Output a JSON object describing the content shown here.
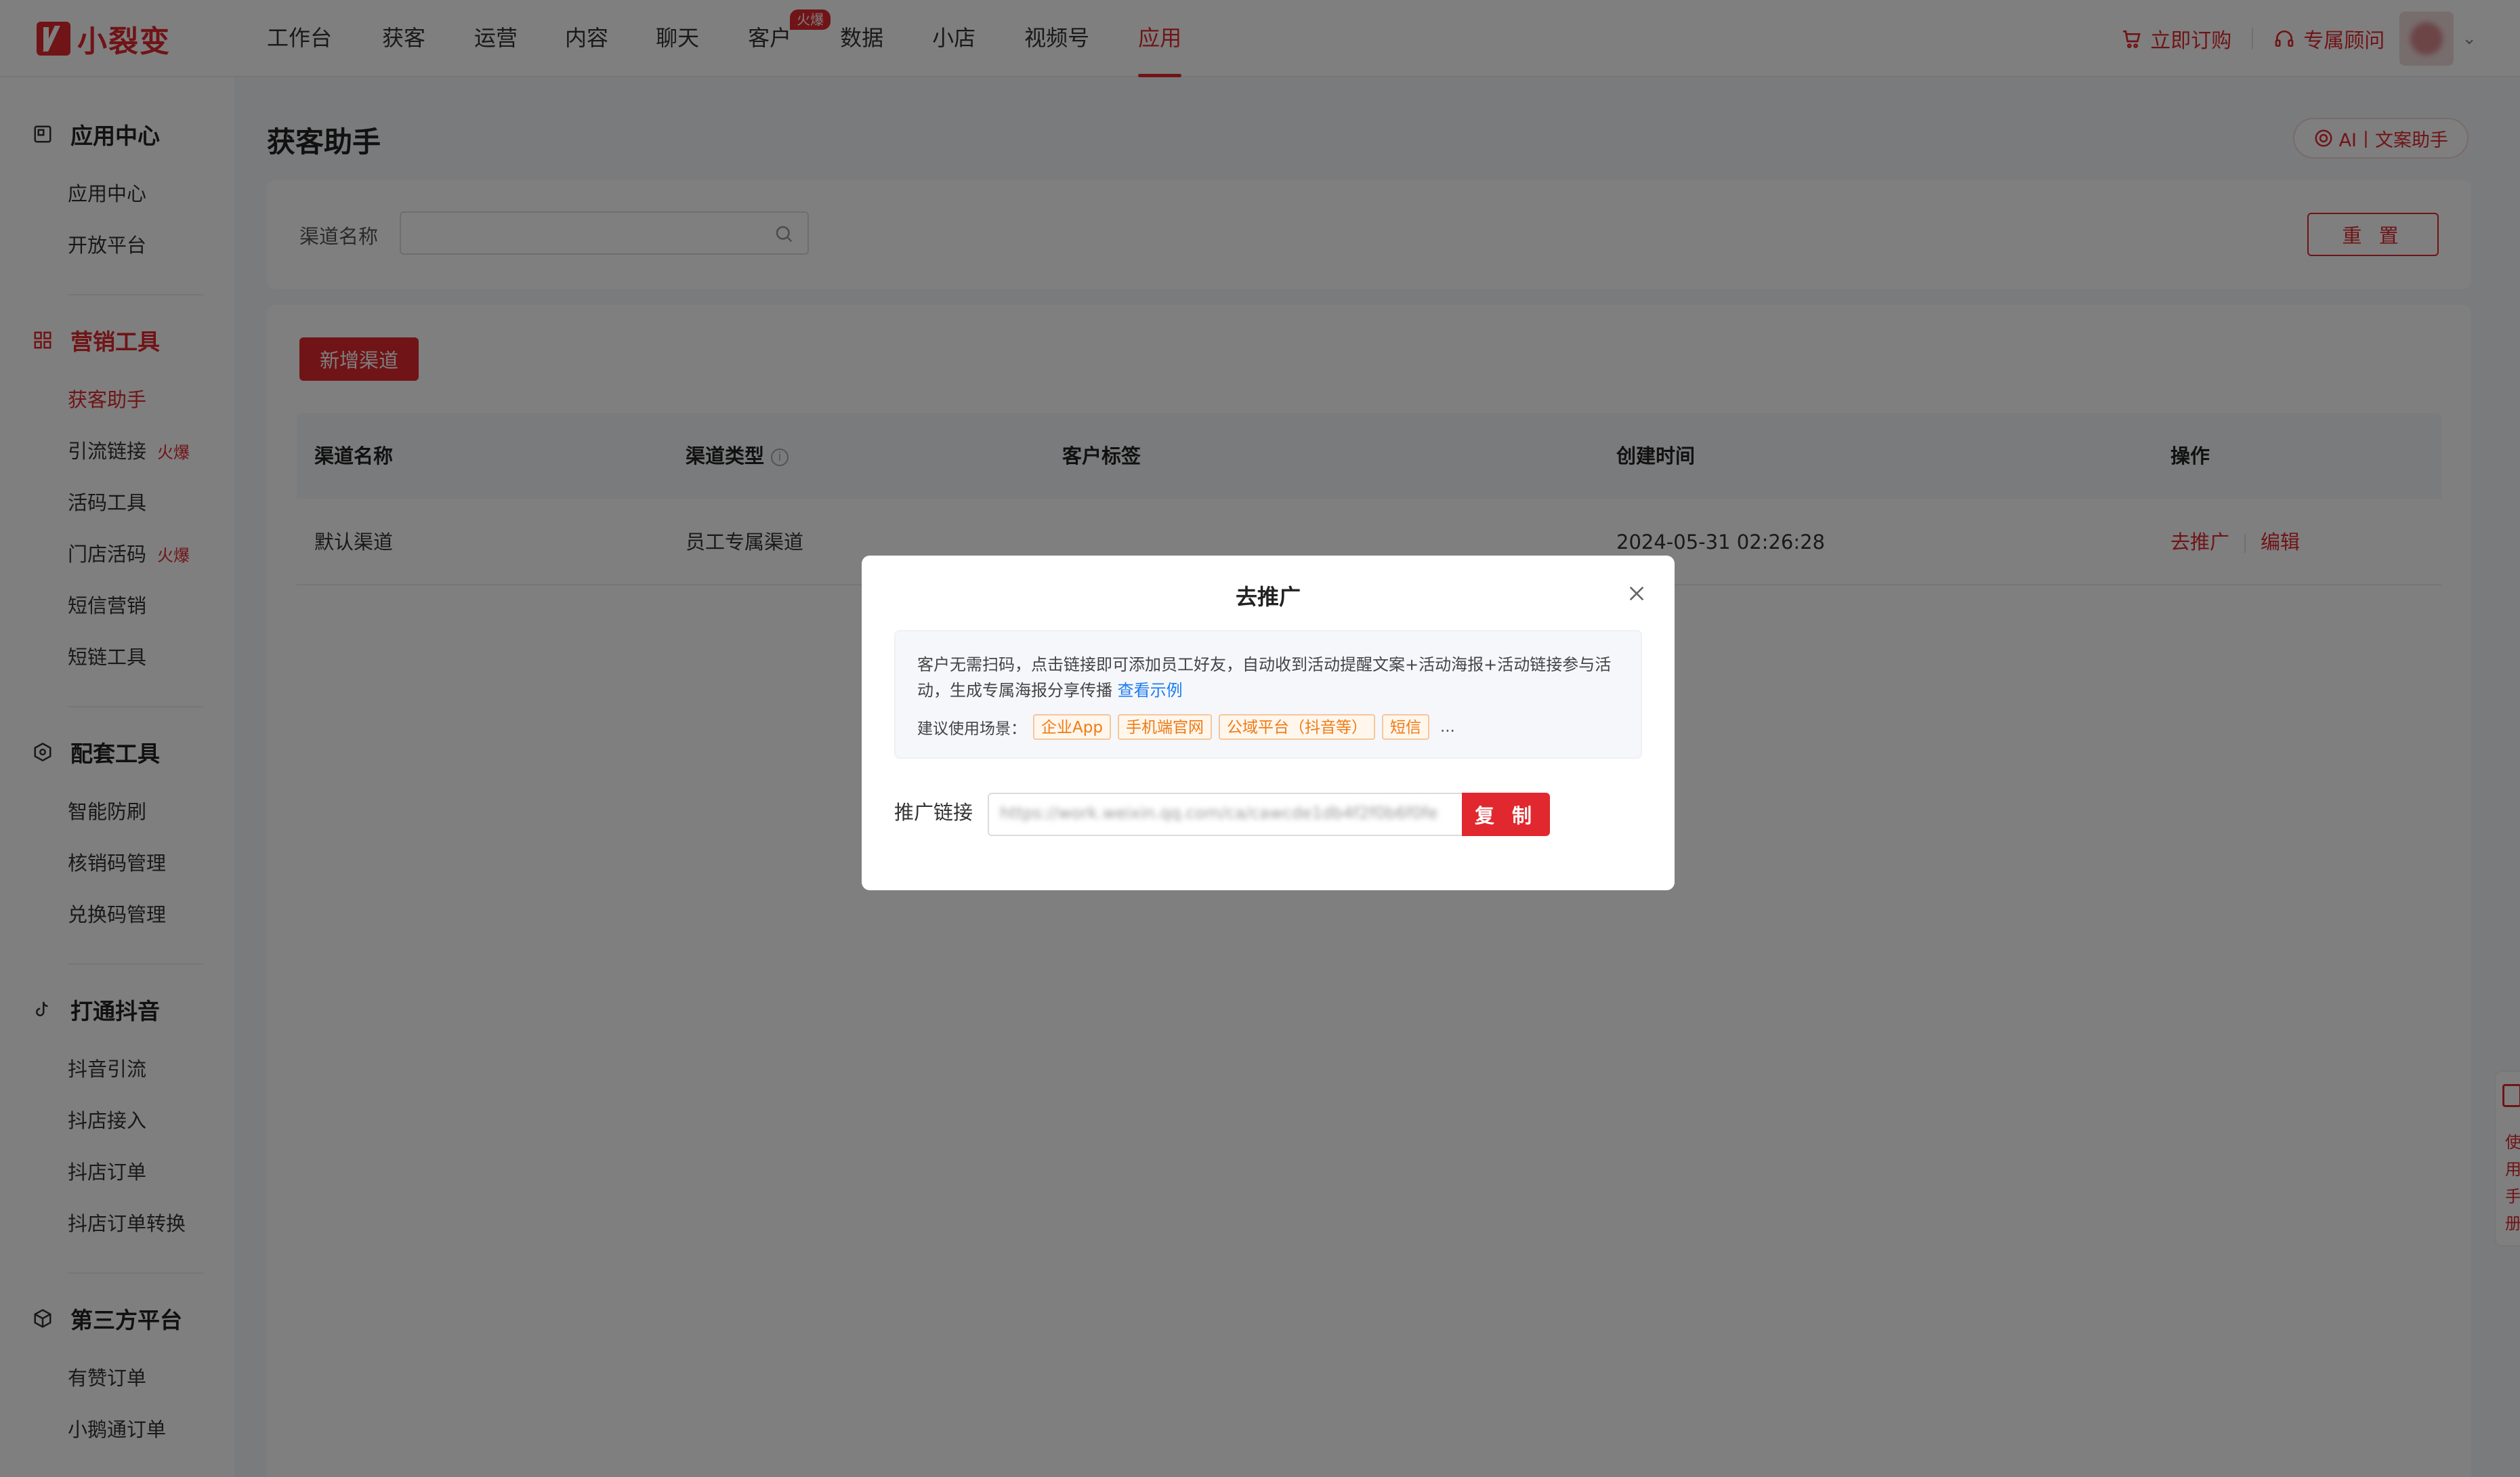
{
  "brand": {
    "name": "小裂变",
    "color": "#e0282e"
  },
  "nav": {
    "items": [
      {
        "label": "工作台"
      },
      {
        "label": "获客"
      },
      {
        "label": "运营"
      },
      {
        "label": "内容"
      },
      {
        "label": "聊天"
      },
      {
        "label": "客户",
        "badge": "火爆"
      },
      {
        "label": "数据"
      },
      {
        "label": "小店"
      },
      {
        "label": "视频号"
      },
      {
        "label": "应用",
        "active": true
      }
    ],
    "order_label": "立即订购",
    "advisor_label": "专属顾问"
  },
  "sidebar": {
    "groups": [
      {
        "title": "应用中心",
        "icon": "app-center-icon",
        "items": [
          {
            "label": "应用中心"
          },
          {
            "label": "开放平台"
          }
        ]
      },
      {
        "title": "营销工具",
        "icon": "grid-icon",
        "active": true,
        "items": [
          {
            "label": "获客助手",
            "active": true
          },
          {
            "label": "引流链接",
            "hot": "火爆"
          },
          {
            "label": "活码工具"
          },
          {
            "label": "门店活码",
            "hot": "火爆"
          },
          {
            "label": "短信营销"
          },
          {
            "label": "短链工具"
          }
        ]
      },
      {
        "title": "配套工具",
        "icon": "hexagon-icon",
        "items": [
          {
            "label": "智能防刷"
          },
          {
            "label": "核销码管理"
          },
          {
            "label": "兑换码管理"
          }
        ]
      },
      {
        "title": "打通抖音",
        "icon": "douyin-icon",
        "items": [
          {
            "label": "抖音引流"
          },
          {
            "label": "抖店接入"
          },
          {
            "label": "抖店订单"
          },
          {
            "label": "抖店订单转换"
          }
        ]
      },
      {
        "title": "第三方平台",
        "icon": "cube-icon",
        "items": [
          {
            "label": "有赞订单"
          },
          {
            "label": "小鹅通订单"
          }
        ]
      }
    ]
  },
  "main": {
    "title": "获客助手",
    "ai_button": "AI丨文案助手",
    "filter": {
      "label": "渠道名称",
      "value": "",
      "placeholder": ""
    },
    "reset_label": "重 置",
    "add_label": "新增渠道",
    "table": {
      "headers": [
        "渠道名称",
        "渠道类型",
        "客户标签",
        "创建时间",
        "操作"
      ],
      "rows": [
        {
          "name": "默认渠道",
          "type": "员工专属渠道",
          "tags": "",
          "created": "2024-05-31 02:26:28",
          "actions": [
            "去推广",
            "编辑"
          ]
        }
      ]
    }
  },
  "float_tab": {
    "text": "使用手册"
  },
  "modal": {
    "title": "去推广",
    "description": "客户无需扫码，点击链接即可添加员工好友，自动收到活动提醒文案+活动海报+活动链接参与活动，生成专属海报分享传播",
    "example_link": "查看示例",
    "scenario_label": "建议使用场景：",
    "scenarios": [
      "企业App",
      "手机端官网",
      "公域平台（抖音等）",
      "短信"
    ],
    "more": "...",
    "link_label": "推广链接",
    "link_value": "https://work.weixin.qq.com/ca/cawcde1db4f2f0b6f0fe",
    "copy_label": "复 制"
  }
}
